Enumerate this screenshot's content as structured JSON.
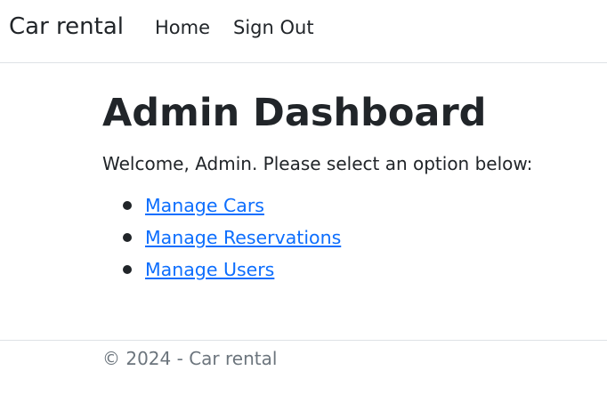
{
  "navbar": {
    "brand": "Car rental",
    "links": [
      "Home",
      "Sign Out"
    ]
  },
  "main": {
    "title": "Admin Dashboard",
    "intro": "Welcome, Admin. Please select an option below:",
    "options": [
      "Manage Cars",
      "Manage Reservations",
      "Manage Users"
    ]
  },
  "footer": {
    "text": "© 2024 - Car rental"
  },
  "colors": {
    "link": "#0d6efd",
    "text": "#212529",
    "muted": "#6c757d",
    "border": "#dee2e6"
  }
}
